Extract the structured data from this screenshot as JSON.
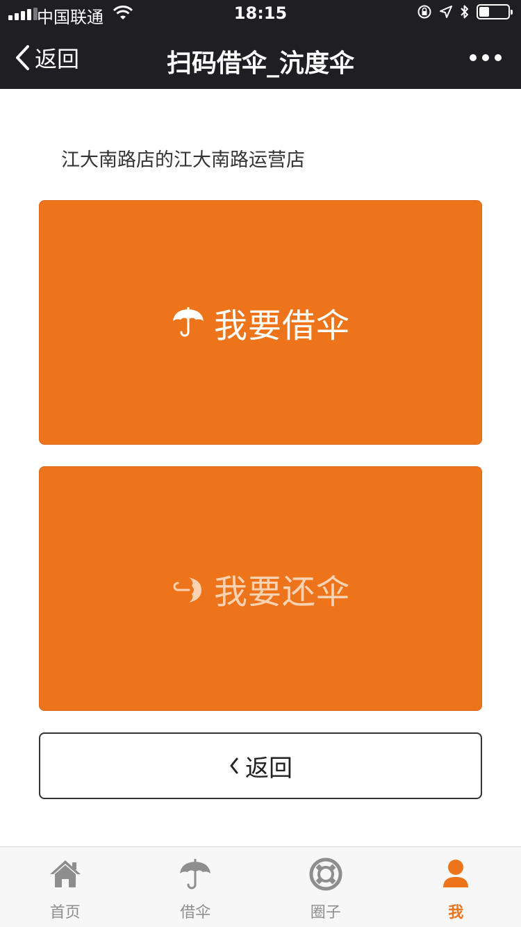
{
  "status_bar": {
    "carrier": "中国联通",
    "time": "18:15",
    "battery_level": 0.35
  },
  "nav": {
    "back_label": "返回",
    "title": "扫码借伞_沆度伞"
  },
  "store": {
    "name": "江大南路店的江大南路运营店"
  },
  "actions": {
    "borrow_label": "我要借伞",
    "return_label": "我要还伞",
    "back_label": "返回"
  },
  "tabs": [
    {
      "label": "首页",
      "icon": "home-icon"
    },
    {
      "label": "借伞",
      "icon": "umbrella-icon"
    },
    {
      "label": "圈子",
      "icon": "lifebuoy-icon"
    },
    {
      "label": "我",
      "icon": "person-icon"
    }
  ],
  "colors": {
    "accent": "#ee741b",
    "nav_background": "#1f1f23",
    "tab_inactive": "#8e8e8e"
  }
}
